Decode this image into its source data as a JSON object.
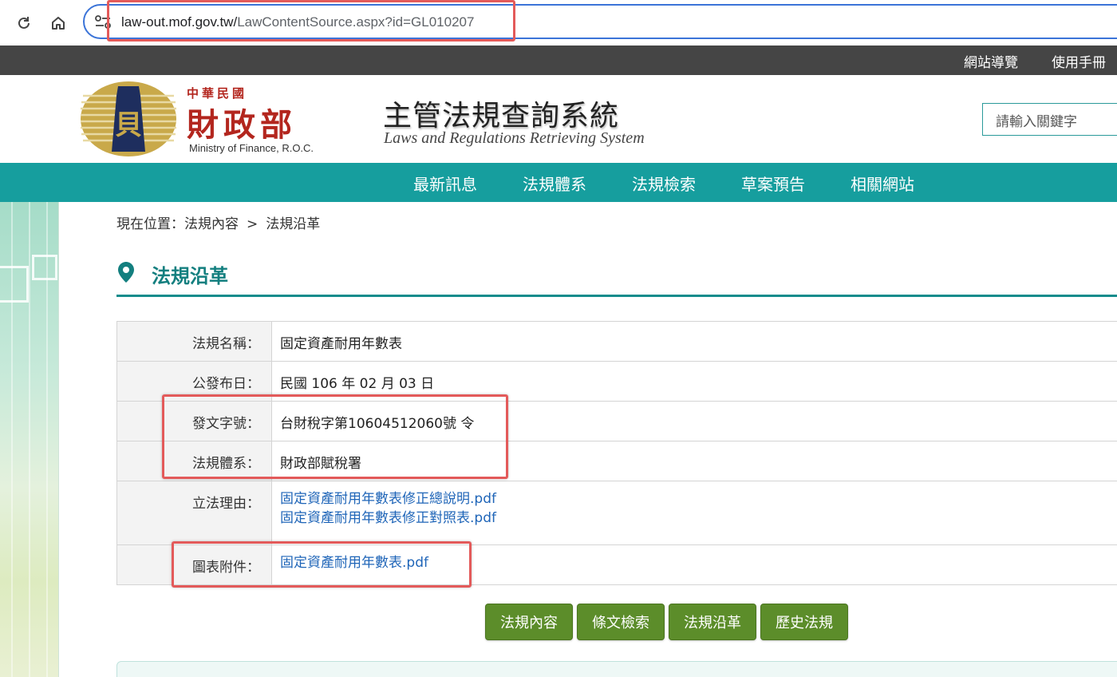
{
  "browser": {
    "url_host": "law-out.mof.gov.tw/",
    "url_path": "LawContentSource.aspx?id=GL010207"
  },
  "top_links": [
    "網站導覽",
    "使用手冊"
  ],
  "header": {
    "org_small": "中華民國",
    "org_name": "財政部",
    "org_en": "Ministry of Finance, R.O.C.",
    "system_title": "主管法規查詢系統",
    "system_en": "Laws and Regulations Retrieving System",
    "search_placeholder": "請輸入關鍵字"
  },
  "nav": [
    "最新訊息",
    "法規體系",
    "法規檢索",
    "草案預告",
    "相關網站"
  ],
  "breadcrumb": {
    "prefix": "現在位置：法規內容",
    "separator": ">",
    "current": "法規沿革"
  },
  "page_title": "法規沿革",
  "info": {
    "name_label": "法規名稱：",
    "name_value": "固定資產耐用年數表",
    "date_label": "公發布日：",
    "date_value": "民國 106 年 02 月 03 日",
    "docno_label": "發文字號：",
    "docno_value": "台財稅字第10604512060號 令",
    "system_label": "法規體系：",
    "system_value": "財政部賦稅署",
    "reason_label": "立法理由：",
    "reason_links": [
      "固定資產耐用年數表修正總說明.pdf",
      "固定資產耐用年數表修正對照表.pdf"
    ],
    "attach_label": "圖表附件：",
    "attach_link": "固定資產耐用年數表.pdf"
  },
  "buttons": [
    "法規內容",
    "條文檢索",
    "法規沿革",
    "歷史法規"
  ],
  "colors": {
    "teal": "#169e9e",
    "dark_strip": "#454545",
    "button_green": "#5c8d2a",
    "highlight_red": "#e35a5a",
    "link_blue": "#1f65b8"
  }
}
